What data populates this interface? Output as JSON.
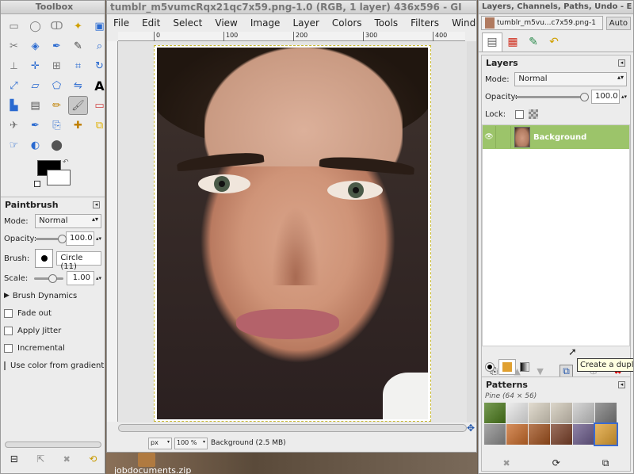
{
  "toolbox": {
    "title": "Toolbox",
    "tools": [
      "rect-select",
      "ellipse-select",
      "free-select",
      "fuzzy-select",
      "by-color-select",
      "scissors-select",
      "foreground-select",
      "paths",
      "color-picker",
      "zoom",
      "measure",
      "move",
      "align",
      "crop",
      "rotate",
      "scale",
      "shear",
      "perspective",
      "flip",
      "text",
      "bucket-fill",
      "blend",
      "pencil",
      "paintbrush",
      "eraser",
      "airbrush",
      "ink",
      "clone",
      "heal",
      "perspective-clone",
      "smudge",
      "dodge-burn",
      "convolve"
    ],
    "fg_color": "#000000",
    "bg_color": "#ffffff"
  },
  "tool_options": {
    "title": "Paintbrush",
    "mode_label": "Mode:",
    "mode_value": "Normal",
    "opacity_label": "Opacity:",
    "opacity_value": "100.0",
    "opacity_level": 1.0,
    "brush_label": "Brush:",
    "brush_value": "Circle (11)",
    "scale_label": "Scale:",
    "scale_value": "1.00",
    "dynamics_label": "Brush Dynamics",
    "fade_label": "Fade out",
    "jitter_label": "Apply Jitter",
    "incremental_label": "Incremental",
    "gradient_label": "Use color from gradient"
  },
  "image_window": {
    "title": "tumblr_m5vumcRqx21qc7x59.png-1.0 (RGB, 1 layer) 436x596 - GI",
    "menus": [
      "File",
      "Edit",
      "Select",
      "View",
      "Image",
      "Layer",
      "Colors",
      "Tools",
      "Filters",
      "Windows",
      "Help"
    ],
    "ruler_marks": [
      "0",
      "100",
      "200",
      "300",
      "400"
    ],
    "unit": "px",
    "zoom": "100 %",
    "status": "Background (2.5 MB)"
  },
  "layers_dock": {
    "title": "Layers, Channels, Paths, Undo - E",
    "image_selector": "tumblr_m5vu...c7x59.png-1",
    "auto_label": "Auto",
    "layers_title": "Layers",
    "mode_label": "Mode:",
    "mode_value": "Normal",
    "opacity_label": "Opacity:",
    "opacity_value": "100.0",
    "opacity_level": 1.0,
    "lock_label": "Lock:",
    "layer_name": "Background",
    "tooltip": "Create a dupl"
  },
  "patterns": {
    "title": "Patterns",
    "selected": "Pine (64 × 56)",
    "swatches": [
      "#4a7a1a",
      "#e8e8e8",
      "#d8d0c0",
      "#d0c8b8",
      "#c8c8c8",
      "#7a7a7a",
      "#8a8a8a",
      "#c86a28",
      "#a0501c",
      "#7a4028",
      "#6a5a8a",
      "#e0a030"
    ]
  },
  "taskbar": {
    "filename": "jobdocuments.zip"
  }
}
